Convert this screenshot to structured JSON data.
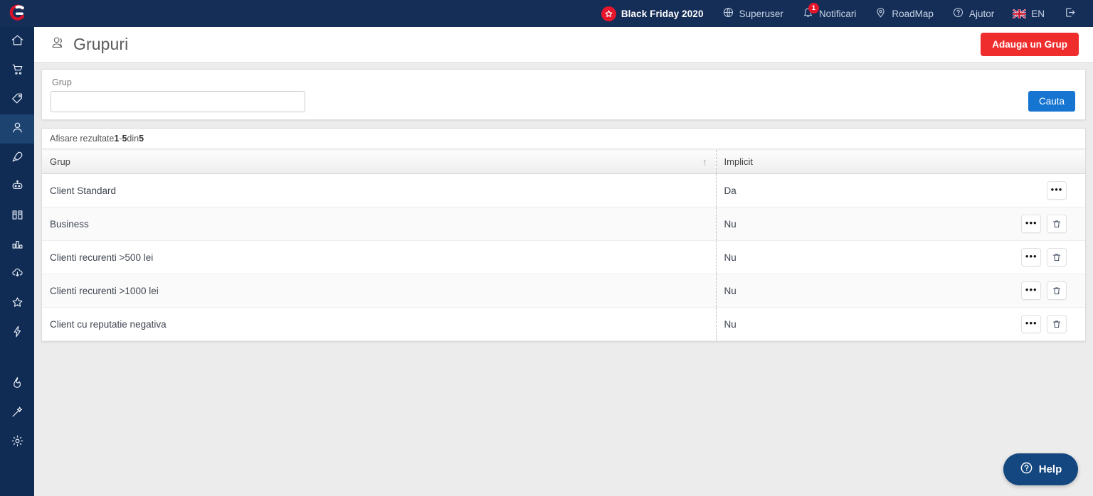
{
  "topbar": {
    "logo_icon": "g-logo-icon",
    "items": [
      {
        "id": "black-friday",
        "label": "Black Friday 2020",
        "icon": "star-icon",
        "highlight_color": "#e8162c"
      },
      {
        "id": "superuser",
        "label": "Superuser",
        "icon": "globe-icon"
      },
      {
        "id": "notificari",
        "label": "Notificari",
        "icon": "bell-icon",
        "badge": "1"
      },
      {
        "id": "roadmap",
        "label": "RoadMap",
        "icon": "map-pin-icon"
      },
      {
        "id": "ajutor",
        "label": "Ajutor",
        "icon": "question-circle-icon"
      },
      {
        "id": "language",
        "label": "EN",
        "icon": "uk-flag-icon"
      },
      {
        "id": "logout",
        "label": "",
        "icon": "logout-icon"
      }
    ]
  },
  "sidebar": {
    "items": [
      {
        "id": "home",
        "icon": "home-icon",
        "active": false
      },
      {
        "id": "orders",
        "icon": "shopping-cart-icon",
        "active": false
      },
      {
        "id": "products",
        "icon": "tag-icon",
        "active": false
      },
      {
        "id": "customers",
        "icon": "user-icon",
        "active": true
      },
      {
        "id": "marketing",
        "icon": "rocket-icon",
        "active": false
      },
      {
        "id": "automation",
        "icon": "robot-icon",
        "active": false
      },
      {
        "id": "catalog",
        "icon": "book-icon",
        "active": false
      },
      {
        "id": "reports",
        "icon": "bar-chart-icon",
        "active": false
      },
      {
        "id": "import-export",
        "icon": "cloud-download-icon",
        "active": false
      },
      {
        "id": "favorites",
        "icon": "star-outline-icon",
        "active": false
      },
      {
        "id": "integrations",
        "icon": "lightning-icon",
        "active": false
      },
      {
        "id": "trending",
        "icon": "flame-icon",
        "active": false
      },
      {
        "id": "design",
        "icon": "magic-wand-icon",
        "active": false
      },
      {
        "id": "settings",
        "icon": "gear-icon",
        "active": false
      }
    ]
  },
  "header": {
    "title": "Grupuri",
    "title_icon": "users-icon",
    "add_button_label": "Adauga un Grup",
    "add_button_color": "#f02d2d"
  },
  "search": {
    "field_label": "Grup",
    "field_value": "",
    "field_placeholder": "",
    "button_label": "Cauta",
    "button_color": "#1675d1"
  },
  "results": {
    "summary_prefix": "Afisare rezultate ",
    "summary_from": "1",
    "summary_dash": " - ",
    "summary_to": "5",
    "summary_mid": " din ",
    "summary_total": "5",
    "columns": [
      {
        "key": "group",
        "label": "Grup",
        "sorted": "asc",
        "sort_icon": "sort-asc-arrow-icon"
      },
      {
        "key": "implicit",
        "label": "Implicit"
      },
      {
        "key": "actions",
        "label": ""
      }
    ],
    "rows": [
      {
        "group": "Client Standard",
        "implicit": "Da",
        "has_delete": false
      },
      {
        "group": "Business",
        "implicit": "Nu",
        "has_delete": true
      },
      {
        "group": "Clienti recurenti >500 lei",
        "implicit": "Nu",
        "has_delete": true
      },
      {
        "group": "Clienti recurenti >1000 lei",
        "implicit": "Nu",
        "has_delete": true
      },
      {
        "group": "Client cu reputatie negativa",
        "implicit": "Nu",
        "has_delete": true
      }
    ],
    "row_menu_icon": "ellipsis-icon",
    "row_delete_icon": "trash-icon"
  },
  "help": {
    "label": "Help",
    "icon": "question-circle-icon",
    "color": "#14477f"
  }
}
